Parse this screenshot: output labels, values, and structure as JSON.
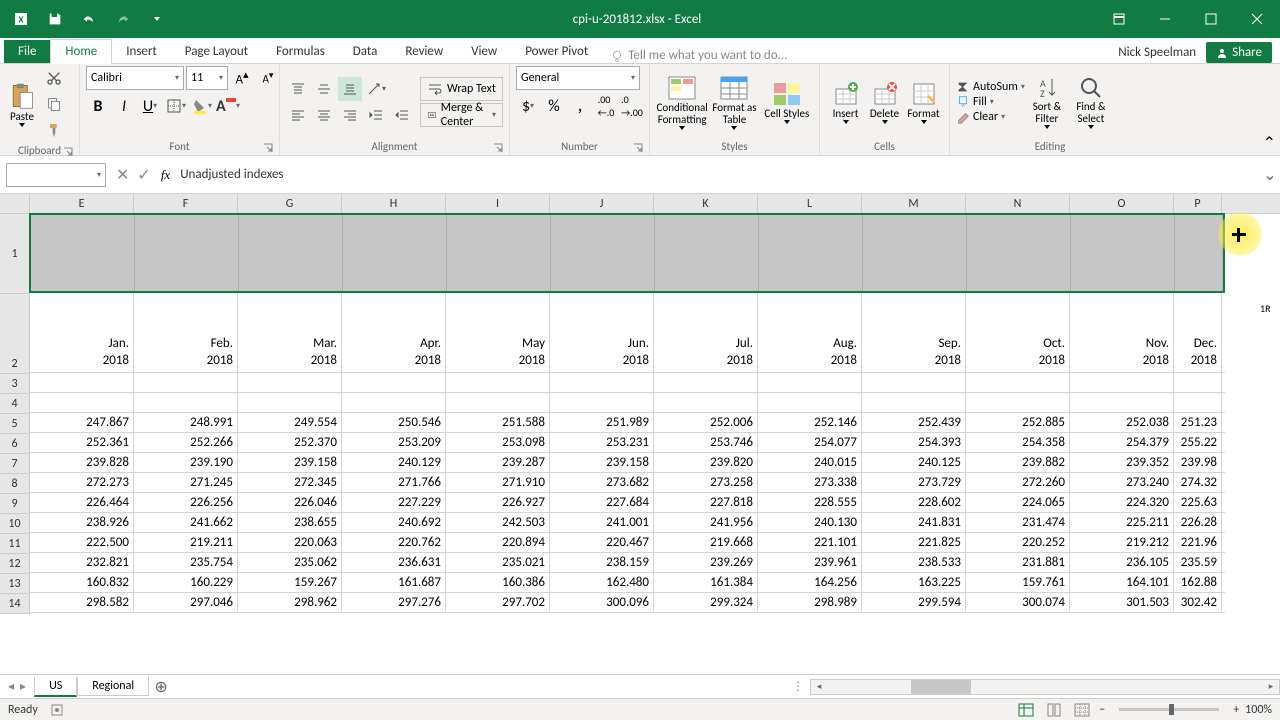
{
  "titlebar": {
    "title": "cpi-u-201812.xlsx - Excel"
  },
  "tabs": {
    "file": "File",
    "home": "Home",
    "insert": "Insert",
    "pagelayout": "Page Layout",
    "formulas": "Formulas",
    "data": "Data",
    "review": "Review",
    "view": "View",
    "powerpivot": "Power Pivot",
    "tellme": "Tell me what you want to do..."
  },
  "account": {
    "user": "Nick Speelman",
    "share": "Share"
  },
  "ribbon": {
    "clipboard": {
      "paste": "Paste",
      "label": "Clipboard"
    },
    "font": {
      "name": "Calibri",
      "size": "11",
      "label": "Font"
    },
    "alignment": {
      "wrap": "Wrap Text",
      "merge": "Merge & Center",
      "label": "Alignment"
    },
    "number": {
      "format": "General",
      "label": "Number"
    },
    "styles": {
      "cond": "Conditional Formatting",
      "table": "Format as Table",
      "cell": "Cell Styles",
      "label": "Styles"
    },
    "cells": {
      "insert": "Insert",
      "delete": "Delete",
      "format": "Format",
      "label": "Cells"
    },
    "editing": {
      "autosum": "AutoSum",
      "fill": "Fill",
      "clear": "Clear",
      "sort": "Sort & Filter",
      "find": "Find & Select",
      "label": "Editing"
    }
  },
  "formula_bar": {
    "value": "Unadjusted indexes"
  },
  "grid": {
    "columns": [
      "E",
      "F",
      "G",
      "H",
      "I",
      "J",
      "K",
      "L",
      "M",
      "N",
      "O",
      "P"
    ],
    "months": [
      {
        "m": "Jan.",
        "y": "2018"
      },
      {
        "m": "Feb.",
        "y": "2018"
      },
      {
        "m": "Mar.",
        "y": "2018"
      },
      {
        "m": "Apr.",
        "y": "2018"
      },
      {
        "m": "May",
        "y": "2018"
      },
      {
        "m": "Jun.",
        "y": "2018"
      },
      {
        "m": "Jul.",
        "y": "2018"
      },
      {
        "m": "Aug.",
        "y": "2018"
      },
      {
        "m": "Sep.",
        "y": "2018"
      },
      {
        "m": "Oct.",
        "y": "2018"
      },
      {
        "m": "Nov.",
        "y": "2018"
      },
      {
        "m": "Dec.",
        "y": "2018"
      }
    ],
    "row_nums": [
      "1",
      "2",
      "3",
      "4",
      "5",
      "6",
      "7",
      "8",
      "9",
      "10",
      "11",
      "12",
      "13",
      "14"
    ],
    "data": [
      [
        "247.867",
        "248.991",
        "249.554",
        "250.546",
        "251.588",
        "251.989",
        "252.006",
        "252.146",
        "252.439",
        "252.885",
        "252.038",
        "251.23"
      ],
      [
        "252.361",
        "252.266",
        "252.370",
        "253.209",
        "253.098",
        "253.231",
        "253.746",
        "254.077",
        "254.393",
        "254.358",
        "254.379",
        "255.22"
      ],
      [
        "239.828",
        "239.190",
        "239.158",
        "240.129",
        "239.287",
        "239.158",
        "239.820",
        "240.015",
        "240.125",
        "239.882",
        "239.352",
        "239.98"
      ],
      [
        "272.273",
        "271.245",
        "272.345",
        "271.766",
        "271.910",
        "273.682",
        "273.258",
        "273.338",
        "273.729",
        "272.260",
        "273.240",
        "274.32"
      ],
      [
        "226.464",
        "226.256",
        "226.046",
        "227.229",
        "226.927",
        "227.684",
        "227.818",
        "228.555",
        "228.602",
        "224.065",
        "224.320",
        "225.63"
      ],
      [
        "238.926",
        "241.662",
        "238.655",
        "240.692",
        "242.503",
        "241.001",
        "241.956",
        "240.130",
        "241.831",
        "231.474",
        "225.211",
        "226.28"
      ],
      [
        "222.500",
        "219.211",
        "220.063",
        "220.762",
        "220.894",
        "220.467",
        "219.668",
        "221.101",
        "221.825",
        "220.252",
        "219.212",
        "221.96"
      ],
      [
        "232.821",
        "235.754",
        "235.062",
        "236.631",
        "235.021",
        "238.159",
        "239.269",
        "239.961",
        "238.533",
        "231.881",
        "236.105",
        "235.59"
      ],
      [
        "160.832",
        "160.229",
        "159.267",
        "161.687",
        "160.386",
        "162.480",
        "161.384",
        "164.256",
        "163.225",
        "159.761",
        "164.101",
        "162.88"
      ],
      [
        "298.582",
        "297.046",
        "298.962",
        "297.276",
        "297.702",
        "300.096",
        "299.324",
        "298.989",
        "299.594",
        "300.074",
        "301.503",
        "302.42"
      ]
    ],
    "sel_count": "1R"
  },
  "sheets": {
    "us": "US",
    "regional": "Regional"
  },
  "statusbar": {
    "ready": "Ready",
    "zoom": "100%"
  }
}
